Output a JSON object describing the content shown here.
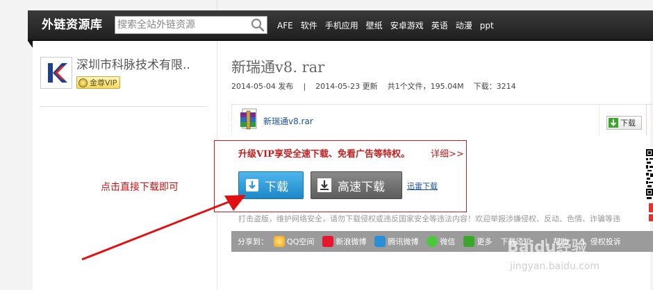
{
  "header": {
    "logo_text": "外链资源库",
    "search": {
      "placeholder": "搜索全站外链资源",
      "value": ""
    },
    "nav_items": [
      "AFE",
      "软件",
      "手机应用",
      "壁纸",
      "安卓游戏",
      "英语",
      "动漫",
      "ppt"
    ]
  },
  "sidebar": {
    "publisher_name": "深圳市科脉技术有限..",
    "vip_badge": "金尊VIP"
  },
  "file": {
    "title": "新瑞通v8. rar",
    "published": "2014-05-04 发布",
    "divider": "|",
    "updated": "2014-05-23 更新",
    "summary": "共1个文件，195.04M",
    "downloads": "下载：3214",
    "item_name": "新瑞通v8.rar",
    "item_download_label": "下载"
  },
  "promo": {
    "text": "升级VIP享受全速下载、免看广告等特权。",
    "more_link": "详细>>",
    "download_button": "下载",
    "fast_download_button": "高速下载",
    "thunder_link": "迅雷下载"
  },
  "annotation": "点击直接下载即可",
  "warning": "打击盗版，维护网络安全，请勿下载侵权或违反国家安全等违法内容！欢迎举报涉嫌侵权、反动、色情、诈骗等违",
  "share": {
    "label": "分享到：",
    "items": [
      "QQ空间",
      "新浪微博",
      "腾讯微博",
      "微信",
      "更多"
    ],
    "extra": [
      "下载须知",
      "帮助",
      "侵权投诉"
    ],
    "separator": "|"
  },
  "colors": {
    "header_bg": "#2b2b2b",
    "accent_red": "#c41e1e",
    "download_blue": "#2a98d8",
    "fast_gray": "#6e6e6e",
    "share_bar": "#9b9b9b"
  },
  "watermark": {
    "brand": "Baidu经验",
    "url": "jingyan.baidu.com"
  }
}
